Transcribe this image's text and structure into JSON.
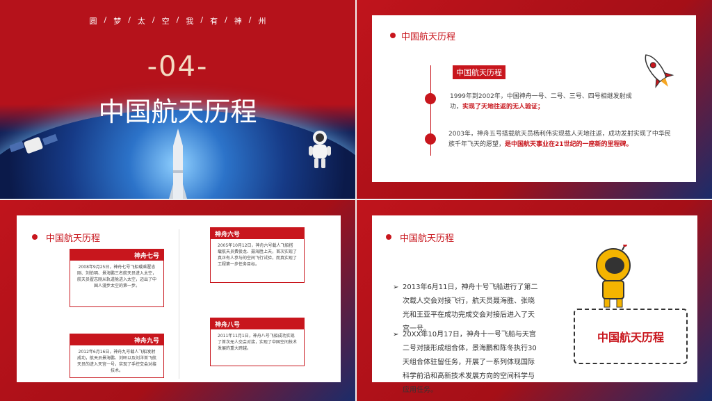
{
  "slide1": {
    "slogan": [
      "圆",
      "/",
      "梦",
      "/",
      "太",
      "/",
      "空",
      "/",
      "我",
      "/",
      "有",
      "/",
      "神",
      "/",
      "州"
    ],
    "number": "-04-",
    "title": "中国航天历程"
  },
  "slide2": {
    "section_title": "中国航天历程",
    "tag": "中国航天历程",
    "item1_text": "1999年到2002年，中国神舟一号、二号、三号、四号相继发射成功，",
    "item1_highlight": "实现了天地往返的无人验证；",
    "item2_text": "2003年，神舟五号搭载航天员杨利伟实现载人天地往返，成功发射实现了中华民族千年飞天的愿望，",
    "item2_highlight": "是中国航天事业在21世纪的一座新的里程碑。"
  },
  "slide3": {
    "section_title": "中国航天历程",
    "cards": [
      {
        "title": "神舟六号",
        "text": "2005年10月12日，神舟六号载人飞船搭载航天员费俊龙、聂海胜上天，首次实现了真正有人参与的空间飞行试验，而真实现了工程第一步任务目标。"
      },
      {
        "title": "神舟七号",
        "text": "2008年9月25日，神舟七号飞船载乘翟志刚、刘伯明、景海鹏三名航天员进入太空，航天员翟志刚从轨道舱进入太空，迈出了中国人漫步太空的第一步。"
      },
      {
        "title": "神舟八号",
        "text": "2011年11月1日，神舟八号飞船成功实现了首次无人交会对接，实现了中国空间技术发展的重大跨越。"
      },
      {
        "title": "神舟九号",
        "text": "2012年6月16日，神舟九号载人飞船发射成功，航天员景海鹏、刘旺以及刘洋首飞航天员的进入天宫一号，实现了手控交会对接技术。"
      }
    ]
  },
  "slide4": {
    "section_title": "中国航天历程",
    "bullets": [
      "2013年6月11日，神舟十号飞船进行了第二次载人交会对接飞行，航天员聂海胜、张晓光和王亚平在成功完成交会对接后进入了天宫一号。",
      "20XX年10月17日，神舟十一号飞船与天宫二号对接形成组合体，景海鹏和陈冬执行30天组合体驻留任务，开展了一系列体现国际科学前沿和高新技术发展方向的空间科学与应用任务。"
    ],
    "sign_text": "中国航天历程"
  },
  "colors": {
    "accent": "#c8161d",
    "navy": "#14205a"
  }
}
